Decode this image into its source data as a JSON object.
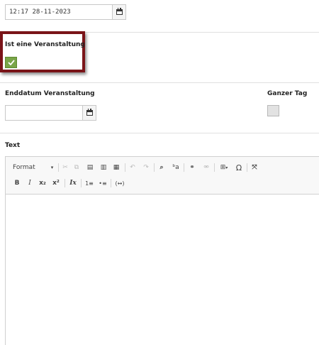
{
  "datetime_field": {
    "value": "12:17 28-11-2023"
  },
  "event_checkbox": {
    "label": "Ist eine Veranstaltung",
    "checked": true
  },
  "end_date": {
    "label": "Enddatum Veranstaltung",
    "value": ""
  },
  "all_day": {
    "label": "Ganzer Tag",
    "checked": false
  },
  "text_editor": {
    "label": "Text",
    "format_label": "Format",
    "toolbar_row1": [
      "cut-icon",
      "copy-icon",
      "paste-icon",
      "paste-text-icon",
      "paste-word-icon",
      "undo-icon",
      "redo-icon",
      "find-icon",
      "replace-icon",
      "link-icon",
      "unlink-icon",
      "table-icon",
      "special-char-icon",
      "maximize-icon"
    ],
    "toolbar_row2": {
      "bold": "B",
      "italic": "I",
      "subscript": "x₂",
      "superscript": "x²",
      "remove_format": "Ix",
      "numbered_list": "1≡",
      "bulleted_list": "•≡",
      "soft_hyphen": "(↔)"
    },
    "omega": "Ω"
  },
  "colors": {
    "check_green": "#79a548",
    "highlight_border": "#7a1418"
  }
}
